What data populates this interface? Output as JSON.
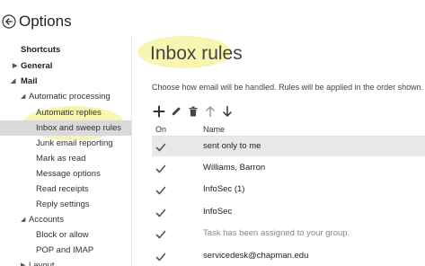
{
  "header": {
    "title": "Options"
  },
  "sidebar": {
    "items": [
      {
        "label": "Shortcuts"
      },
      {
        "label": "General"
      },
      {
        "label": "Mail"
      },
      {
        "label": "Automatic processing"
      },
      {
        "label": "Automatic replies"
      },
      {
        "label": "Inbox and sweep rules"
      },
      {
        "label": "Junk email reporting"
      },
      {
        "label": "Mark as read"
      },
      {
        "label": "Message options"
      },
      {
        "label": "Read receipts"
      },
      {
        "label": "Reply settings"
      },
      {
        "label": "Accounts"
      },
      {
        "label": "Block or allow"
      },
      {
        "label": "POP and IMAP"
      },
      {
        "label": "Layout"
      }
    ]
  },
  "main": {
    "title": "Inbox rules",
    "description": "Choose how email will be handled. Rules will be applied in the order shown.",
    "toolbar": {
      "icons": [
        "add-icon",
        "edit-icon",
        "delete-icon",
        "move-up-icon",
        "move-down-icon"
      ]
    },
    "table": {
      "headers": {
        "on": "On",
        "name": "Name"
      },
      "rows": [
        {
          "name": "sent only to me",
          "checked": true,
          "selected": true
        },
        {
          "name": "Williams, Barron",
          "checked": true
        },
        {
          "name": "InfoSec (1)",
          "checked": true
        },
        {
          "name": "InfoSec",
          "checked": true
        },
        {
          "name": "Task has been assigned to your group.",
          "checked": true
        },
        {
          "name": "servicedesk@chapman.edu",
          "checked": true
        }
      ]
    }
  },
  "colors": {
    "highlight": "#f0ec6e",
    "selected_nav": "#d9d9d9",
    "selected_row": "#e8e8e8",
    "check": "#555555"
  }
}
